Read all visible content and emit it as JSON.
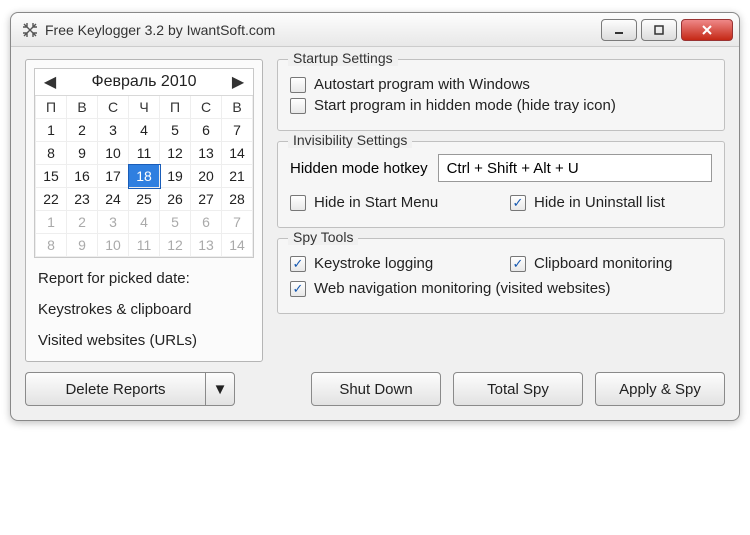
{
  "window": {
    "title": "Free Keylogger 3.2 by IwantSoft.com"
  },
  "calendar": {
    "month_label": "Февраль 2010",
    "weekdays": [
      "П",
      "В",
      "С",
      "Ч",
      "П",
      "С",
      "В"
    ],
    "rows": [
      [
        {
          "d": "1"
        },
        {
          "d": "2"
        },
        {
          "d": "3"
        },
        {
          "d": "4"
        },
        {
          "d": "5"
        },
        {
          "d": "6"
        },
        {
          "d": "7"
        }
      ],
      [
        {
          "d": "8"
        },
        {
          "d": "9"
        },
        {
          "d": "10"
        },
        {
          "d": "11"
        },
        {
          "d": "12"
        },
        {
          "d": "13"
        },
        {
          "d": "14"
        }
      ],
      [
        {
          "d": "15"
        },
        {
          "d": "16"
        },
        {
          "d": "17"
        },
        {
          "d": "18",
          "sel": true
        },
        {
          "d": "19"
        },
        {
          "d": "20"
        },
        {
          "d": "21"
        }
      ],
      [
        {
          "d": "22"
        },
        {
          "d": "23"
        },
        {
          "d": "24"
        },
        {
          "d": "25"
        },
        {
          "d": "26"
        },
        {
          "d": "27"
        },
        {
          "d": "28"
        }
      ],
      [
        {
          "d": "1",
          "other": true
        },
        {
          "d": "2",
          "other": true
        },
        {
          "d": "3",
          "other": true
        },
        {
          "d": "4",
          "other": true
        },
        {
          "d": "5",
          "other": true
        },
        {
          "d": "6",
          "other": true
        },
        {
          "d": "7",
          "other": true
        }
      ],
      [
        {
          "d": "8",
          "other": true
        },
        {
          "d": "9",
          "other": true
        },
        {
          "d": "10",
          "other": true
        },
        {
          "d": "11",
          "other": true
        },
        {
          "d": "12",
          "other": true
        },
        {
          "d": "13",
          "other": true
        },
        {
          "d": "14",
          "other": true
        }
      ]
    ]
  },
  "left": {
    "report_label": "Report for picked date:",
    "link_keystrokes": "Keystrokes & clipboard",
    "link_urls": "Visited websites (URLs)"
  },
  "startup": {
    "legend": "Startup Settings",
    "autostart": {
      "label": "Autostart program with Windows",
      "checked": false
    },
    "hidden_start": {
      "label": "Start program in hidden mode (hide tray icon)",
      "checked": false
    }
  },
  "invisibility": {
    "legend": "Invisibility Settings",
    "hotkey_label": "Hidden mode hotkey",
    "hotkey_value": "Ctrl + Shift + Alt + U",
    "hide_start_menu": {
      "label": "Hide in Start Menu",
      "checked": false
    },
    "hide_uninstall": {
      "label": "Hide in Uninstall list",
      "checked": true
    }
  },
  "spytools": {
    "legend": "Spy Tools",
    "keystroke": {
      "label": "Keystroke logging",
      "checked": true
    },
    "clipboard": {
      "label": "Clipboard monitoring",
      "checked": true
    },
    "webnav": {
      "label": "Web navigation monitoring (visited websites)",
      "checked": true
    }
  },
  "buttons": {
    "delete_reports": "Delete Reports",
    "shut_down": "Shut Down",
    "total_spy": "Total Spy",
    "apply_spy": "Apply & Spy"
  }
}
